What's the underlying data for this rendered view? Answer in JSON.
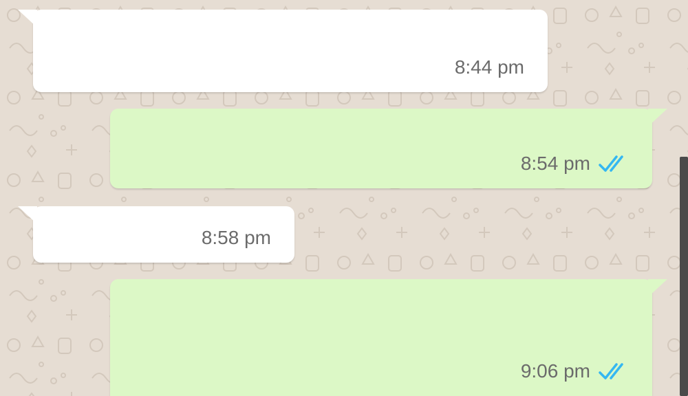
{
  "messages": [
    {
      "direction": "incoming",
      "text": "",
      "time": "8:44 pm"
    },
    {
      "direction": "outgoing",
      "text": "",
      "time": "8:54 pm",
      "status": "read",
      "status_icon": "double-check-icon"
    },
    {
      "direction": "incoming",
      "text": "",
      "time": "8:58 pm"
    },
    {
      "direction": "outgoing",
      "text": "",
      "time": "9:06 pm",
      "status": "read",
      "status_icon": "double-check-icon"
    }
  ],
  "colors": {
    "wallpaper": "#e6ddd3",
    "incoming_bubble": "#ffffff",
    "outgoing_bubble": "#dcf8c6",
    "timestamp": "#6b6b6b",
    "read_ticks": "#34b7f1"
  }
}
